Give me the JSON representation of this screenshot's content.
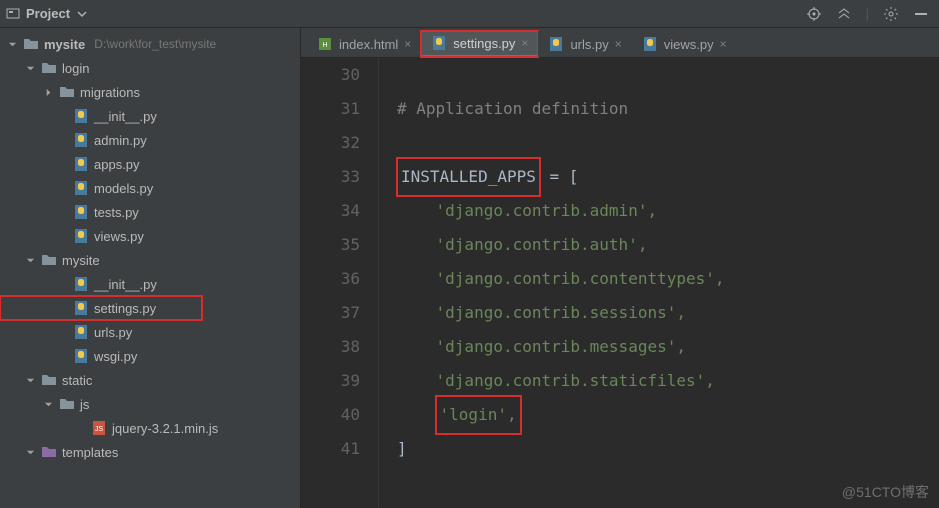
{
  "toolbar": {
    "project_label": "Project"
  },
  "tree": {
    "root": {
      "name": "mysite",
      "path": "D:\\work\\for_test\\mysite"
    },
    "login": {
      "name": "login"
    },
    "migrations": {
      "name": "migrations"
    },
    "login_files": {
      "init": "__init__.py",
      "admin": "admin.py",
      "apps": "apps.py",
      "models": "models.py",
      "tests": "tests.py",
      "views": "views.py"
    },
    "mysite_pkg": {
      "name": "mysite"
    },
    "mysite_files": {
      "init": "__init__.py",
      "settings": "settings.py",
      "urls": "urls.py",
      "wsgi": "wsgi.py"
    },
    "static": {
      "name": "static",
      "js": "js",
      "jquery": "jquery-3.2.1.min.js"
    },
    "templates": {
      "name": "templates"
    }
  },
  "tabs": {
    "t0": "index.html",
    "t1": "settings.py",
    "t2": "urls.py",
    "t3": "views.py"
  },
  "code": {
    "l30": "30",
    "l31": "31",
    "l32": "32",
    "l33": "33",
    "l34": "34",
    "l35": "35",
    "l36": "36",
    "l37": "37",
    "l38": "38",
    "l39": "39",
    "l40": "40",
    "l41": "41",
    "comment": "# Application definition",
    "var": "INSTALLED_APPS",
    "eq": " = [",
    "s1": "'django.contrib.admin',",
    "s2": "'django.contrib.auth',",
    "s3": "'django.contrib.contenttypes',",
    "s4": "'django.contrib.sessions',",
    "s5": "'django.contrib.messages',",
    "s6": "'django.contrib.staticfiles',",
    "s7": "'login',",
    "end": "]"
  },
  "watermark": "@51CTO博客"
}
